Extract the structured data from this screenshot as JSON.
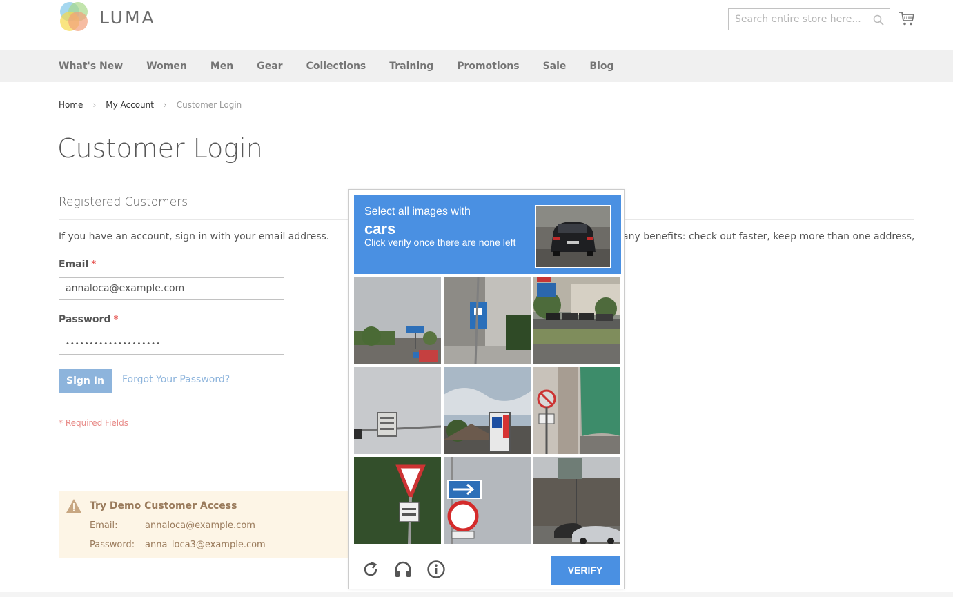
{
  "header": {
    "brand": "LUMA",
    "search_placeholder": "Search entire store here..."
  },
  "nav": {
    "items": [
      "What's New",
      "Women",
      "Men",
      "Gear",
      "Collections",
      "Training",
      "Promotions",
      "Sale",
      "Blog"
    ]
  },
  "breadcrumb": {
    "items": [
      "Home",
      "My Account",
      "Customer Login"
    ]
  },
  "page": {
    "title": "Customer Login",
    "section_title": "Registered Customers",
    "intro": "If you have an account, sign in with your email address.",
    "right_intro": "any benefits: check out faster, keep more than one address,"
  },
  "form": {
    "email_label": "Email",
    "email_value": "annaloca@example.com",
    "password_label": "Password",
    "password_value": "••••••••••••••••••••",
    "required_mark": "*",
    "signin_label": "Sign In",
    "forgot_label": "Forgot Your Password?",
    "required_note": "* Required Fields"
  },
  "demo": {
    "title": "Try Demo Customer Access",
    "email_key": "Email:",
    "email_value": "annaloca@example.com",
    "password_key": "Password:",
    "password_value": "anna_loca3@example.com"
  },
  "captcha": {
    "line1": "Select all images with",
    "target": "cars",
    "line3": "Click verify once there are none left",
    "verify_label": "VERIFY",
    "accent": "#4a90e2",
    "icons": [
      "reload-icon",
      "headphones-icon",
      "info-icon"
    ]
  },
  "colors": {
    "nav_bg": "#f0f0f0",
    "signin_btn": "#8db4dc",
    "demo_bg": "#fdf5e6",
    "required": "#e02b27"
  }
}
